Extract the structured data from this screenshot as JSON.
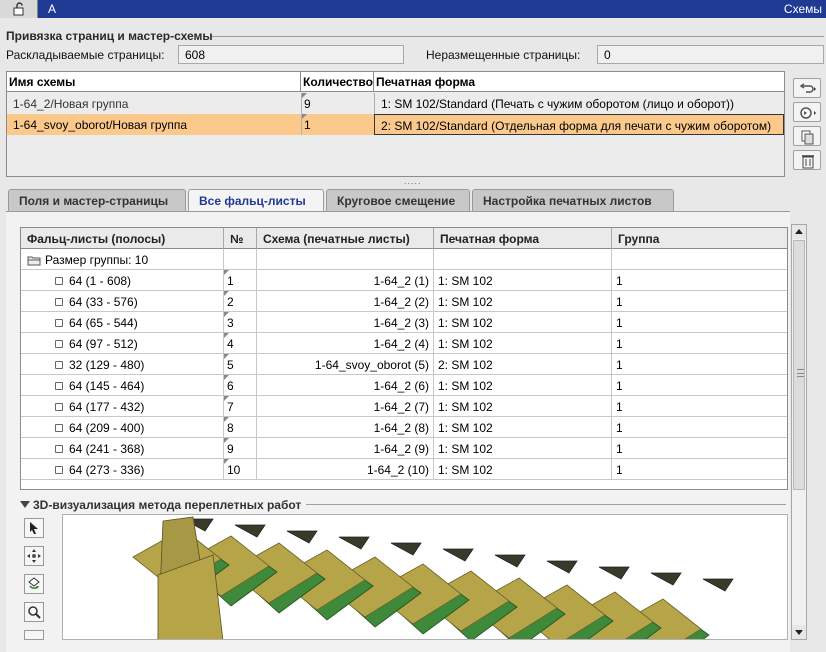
{
  "topbar": {
    "title_left": "A",
    "title_right": "Схемы"
  },
  "binding": {
    "title": "Привязка страниц и мастер-схемы",
    "imposed_label": "Раскладываемые страницы:",
    "imposed_value": "608",
    "unplaced_label": "Неразмещенные страницы:",
    "unplaced_value": "0"
  },
  "schema_table": {
    "headers": {
      "name": "Имя схемы",
      "count": "Количество",
      "form": "Печатная форма"
    },
    "rows": [
      {
        "name": "1-64_2/Новая группа",
        "count": "9",
        "form": "1: SM 102/Standard (Печать с чужим оборотом (лицо и оборот))"
      },
      {
        "name": "1-64_svoy_oborot/Новая группа",
        "count": "1",
        "form": "2: SM 102/Standard (Отдельная форма для печати с чужим оборотом)"
      }
    ]
  },
  "splitter": {
    "grip": "....."
  },
  "tabs": [
    {
      "label": "Поля и мастер-страницы"
    },
    {
      "label": "Все фальц-листы"
    },
    {
      "label": "Круговое смещение"
    },
    {
      "label": "Настройка печатных листов"
    }
  ],
  "fold_table": {
    "headers": {
      "sheets": "Фальц-листы (полосы)",
      "num": "№",
      "schema": "Схема (печатные листы)",
      "form": "Печатная форма",
      "group": "Группа"
    },
    "group_label": "Размер группы: 10",
    "rows": [
      {
        "sheets": "64 (1 - 608)",
        "num": "1",
        "schema": "1-64_2  (1)",
        "form": "1: SM 102",
        "group": "1"
      },
      {
        "sheets": "64 (33 - 576)",
        "num": "2",
        "schema": "1-64_2  (2)",
        "form": "1: SM 102",
        "group": "1"
      },
      {
        "sheets": "64 (65 - 544)",
        "num": "3",
        "schema": "1-64_2  (3)",
        "form": "1: SM 102",
        "group": "1"
      },
      {
        "sheets": "64 (97 - 512)",
        "num": "4",
        "schema": "1-64_2  (4)",
        "form": "1: SM 102",
        "group": "1"
      },
      {
        "sheets": "32 (129 - 480)",
        "num": "5",
        "schema": "1-64_svoy_oborot  (5)",
        "form": "2: SM 102",
        "group": "1"
      },
      {
        "sheets": "64 (145 - 464)",
        "num": "6",
        "schema": "1-64_2  (6)",
        "form": "1: SM 102",
        "group": "1"
      },
      {
        "sheets": "64 (177 - 432)",
        "num": "7",
        "schema": "1-64_2  (7)",
        "form": "1: SM 102",
        "group": "1"
      },
      {
        "sheets": "64 (209 - 400)",
        "num": "8",
        "schema": "1-64_2  (8)",
        "form": "1: SM 102",
        "group": "1"
      },
      {
        "sheets": "64 (241 - 368)",
        "num": "9",
        "schema": "1-64_2  (9)",
        "form": "1: SM 102",
        "group": "1"
      },
      {
        "sheets": "64 (273 - 336)",
        "num": "10",
        "schema": "1-64_2  (10)",
        "form": "1: SM 102",
        "group": "1"
      }
    ]
  },
  "viz": {
    "title": "3D-визуализация метода переплетных работ"
  },
  "colors": {
    "topbar": "#1f3a93",
    "selected_row": "#fcc98c",
    "paper_olive": "#b6a548",
    "paper_green": "#3f8a3a"
  },
  "icons": [
    "lock-open-icon",
    "folder-group-icon",
    "checkbox-icon",
    "pointer-icon",
    "move-icon",
    "rotate-icon",
    "zoom-icon"
  ]
}
